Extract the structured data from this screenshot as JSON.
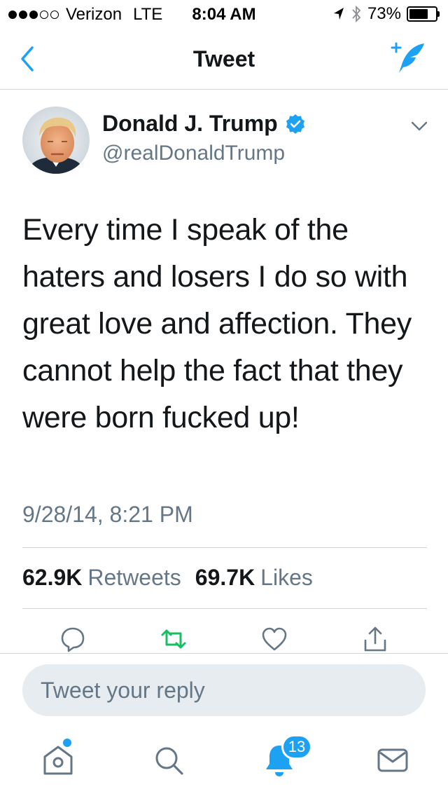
{
  "status_bar": {
    "carrier": "Verizon",
    "network": "LTE",
    "time": "8:04 AM",
    "battery": "73%",
    "battery_level": 0.73,
    "signal_bars": 3,
    "signal_total": 5
  },
  "nav": {
    "title": "Tweet",
    "back_icon": "chevron-left-icon",
    "compose_icon": "compose-tweet-icon"
  },
  "tweet": {
    "author_name": "Donald J. Trump",
    "author_handle": "@realDonaldTrump",
    "verified": true,
    "text": "Every time I speak of the haters and losers I do so with great love and affection. They cannot help the fact that they were born fucked up!",
    "timestamp": "9/28/14, 8:21 PM",
    "retweet_count": "62.9K",
    "retweet_label": "Retweets",
    "like_count": "69.7K",
    "like_label": "Likes"
  },
  "reply": {
    "placeholder": "Tweet your reply"
  },
  "tabs": {
    "notifications_badge": "13"
  },
  "colors": {
    "accent": "#1da1f2",
    "text_primary": "#14171a",
    "text_secondary": "#657786",
    "retweet_green": "#17bf63",
    "divider": "#cfd5da",
    "reply_bg": "#e6ecf0"
  }
}
